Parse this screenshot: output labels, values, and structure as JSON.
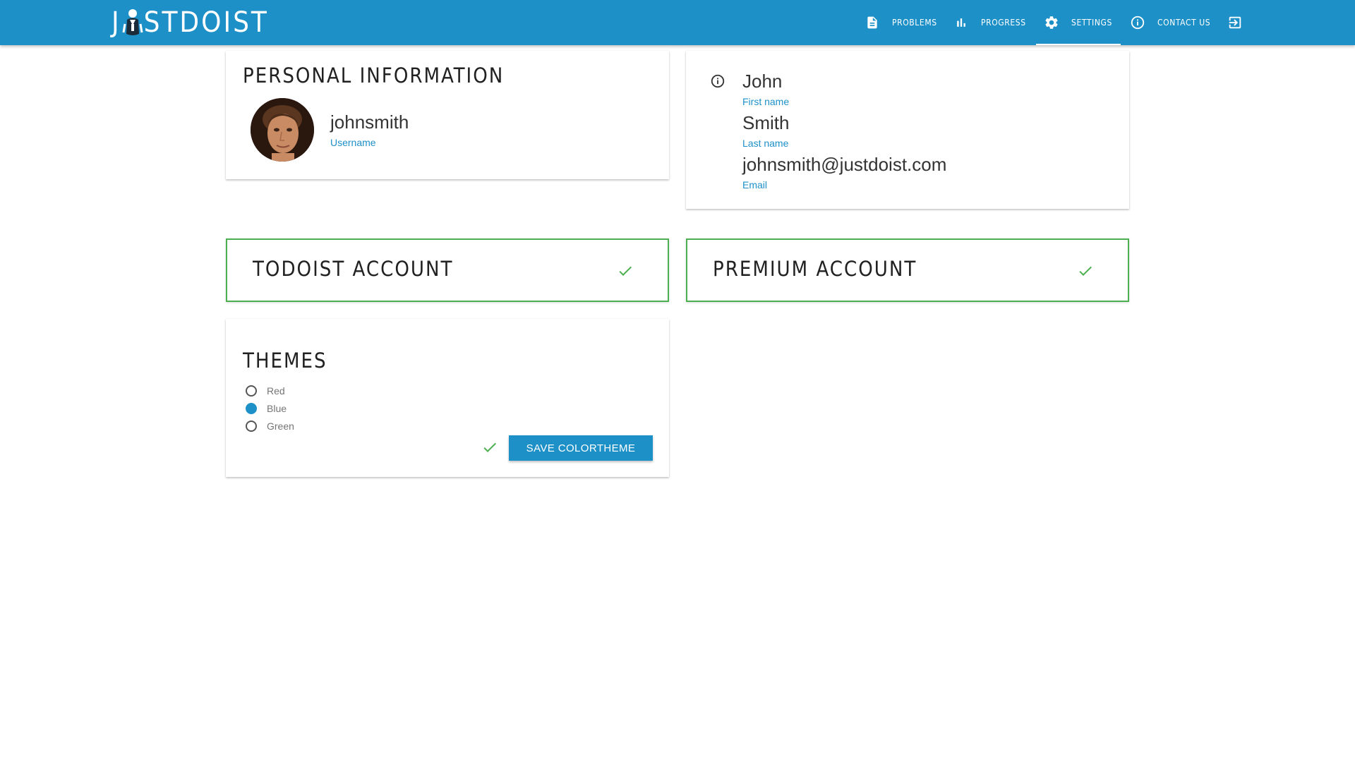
{
  "app": {
    "logo_text_start": "J",
    "logo_text_end": "STDOIST"
  },
  "nav": {
    "items": [
      {
        "label": "PROBLEMS",
        "icon": "document-icon"
      },
      {
        "label": "PROGRESS",
        "icon": "bar-chart-icon"
      },
      {
        "label": "SETTINGS",
        "icon": "gear-icon",
        "active": true
      },
      {
        "label": "CONTACT US",
        "icon": "info-icon"
      }
    ],
    "logout_icon": "logout-icon"
  },
  "personal": {
    "title": "PERSONAL INFORMATION",
    "username": "johnsmith",
    "username_label": "Username"
  },
  "details": {
    "first_name": "John",
    "first_name_label": "First name",
    "last_name": "Smith",
    "last_name_label": "Last name",
    "email": "johnsmith@justdoist.com",
    "email_label": "Email"
  },
  "accounts": {
    "todoist_title": "TODOIST ACCOUNT",
    "premium_title": "PREMIUM ACCOUNT",
    "todoist_status": "check-icon",
    "premium_status": "check-icon"
  },
  "themes": {
    "title": "THEMES",
    "options": [
      {
        "label": "Red",
        "selected": false
      },
      {
        "label": "Blue",
        "selected": true
      },
      {
        "label": "Green",
        "selected": false
      }
    ],
    "save_label": "SAVE COLORTHEME"
  },
  "colors": {
    "primary": "#1e90c8",
    "success": "#4caf50",
    "label": "#1e90c8"
  }
}
